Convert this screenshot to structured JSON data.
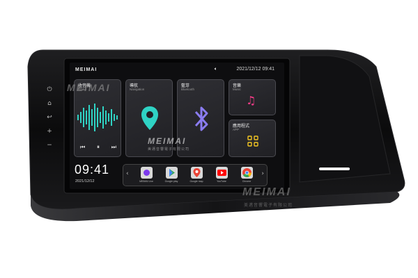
{
  "device": {
    "brand": "MEIMAI",
    "side_buttons": [
      "⏻",
      "⌂",
      "↩",
      "+",
      "−"
    ]
  },
  "status_bar": {
    "volume_icon": "speaker-icon",
    "datetime": "2021/12/12 09:41"
  },
  "cards": {
    "radio": {
      "title": "收音機",
      "subtitle": "Radio"
    },
    "navigation": {
      "title": "導航",
      "subtitle": "Navigation"
    },
    "bluetooth": {
      "title": "藍芽",
      "subtitle": "Bluetooth"
    },
    "music": {
      "title": "音樂",
      "subtitle": "Music"
    },
    "app": {
      "title": "應用程式",
      "subtitle": "APP"
    }
  },
  "radio_controls": [
    "⏮",
    "⏸",
    "⏭"
  ],
  "clock": {
    "time": "09:41",
    "date": "2021/12/12"
  },
  "dock": {
    "apps": [
      {
        "label": "MEIMAI Live",
        "color": "#7c3aed"
      },
      {
        "label": "Google play",
        "color": "#ffffff"
      },
      {
        "label": "Google map",
        "color": "#34a853"
      },
      {
        "label": "YouTube",
        "color": "#ff0000"
      },
      {
        "label": "Chrome",
        "color": "#fbbc05"
      }
    ]
  },
  "watermark": {
    "text": "MEIMAI",
    "subtext": "美邁音響電子有限公司"
  },
  "colors": {
    "accent_teal": "#2fd3c4",
    "accent_pink": "#ff3d8b",
    "bluetooth_purple": "#8a7cf0",
    "app_yellow": "#f3c623"
  }
}
